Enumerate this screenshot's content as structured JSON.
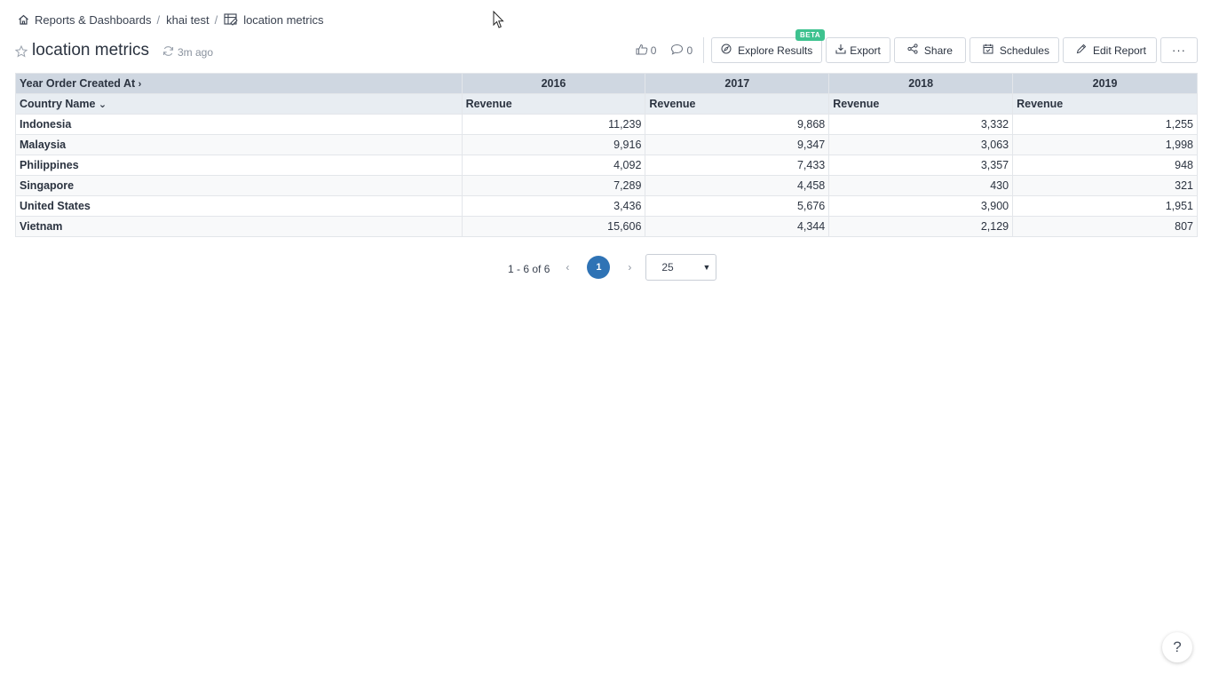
{
  "breadcrumb": {
    "items": [
      {
        "label": "Reports & Dashboards",
        "icon": "home-icon"
      },
      {
        "label": "khai test",
        "icon": ""
      },
      {
        "label": "location metrics",
        "icon": "report-icon"
      }
    ],
    "separator": "/"
  },
  "header": {
    "title": "location metrics",
    "refresh_label": "3m ago",
    "likes": "0",
    "comments": "0"
  },
  "toolbar": {
    "explore_label": "Explore Results",
    "explore_badge": "BETA",
    "export_label": "Export",
    "share_label": "Share",
    "schedules_label": "Schedules",
    "edit_label": "Edit Report",
    "more_label": "···"
  },
  "table": {
    "column_dimension": "Year Order Created At",
    "row_dimension": "Country Name",
    "years": [
      "2016",
      "2017",
      "2018",
      "2019"
    ],
    "metric": "Revenue",
    "rows": [
      {
        "country": "Indonesia",
        "values": [
          "11,239",
          "9,868",
          "3,332",
          "1,255"
        ]
      },
      {
        "country": "Malaysia",
        "values": [
          "9,916",
          "9,347",
          "3,063",
          "1,998"
        ]
      },
      {
        "country": "Philippines",
        "values": [
          "4,092",
          "7,433",
          "3,357",
          "948"
        ]
      },
      {
        "country": "Singapore",
        "values": [
          "7,289",
          "4,458",
          "430",
          "321"
        ]
      },
      {
        "country": "United States",
        "values": [
          "3,436",
          "5,676",
          "3,900",
          "1,951"
        ]
      },
      {
        "country": "Vietnam",
        "values": [
          "15,606",
          "4,344",
          "2,129",
          "807"
        ]
      }
    ]
  },
  "pagination": {
    "range": "1 - 6 of 6",
    "current_page": "1",
    "prev": "‹",
    "next": "›",
    "page_size": "25"
  },
  "help": {
    "label": "?"
  },
  "colors": {
    "accent": "#2f73b5",
    "badge": "#3ec28f",
    "header_row": "#cfd7e1",
    "subheader_row": "#e8edf2"
  }
}
